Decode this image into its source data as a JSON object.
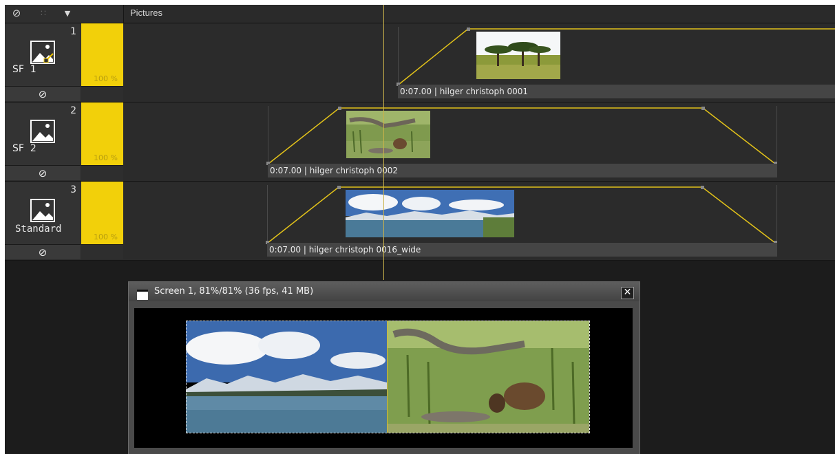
{
  "header": {
    "title": "Pictures",
    "disable_icon": "⊘",
    "dotted_icon": "∷",
    "dropdown_icon": "▼"
  },
  "tracks": [
    {
      "number": "1",
      "name": "SF  1",
      "opacity_label": "100 %",
      "opacity": 1.0,
      "mute_icon": "⊘",
      "clip_label": "0:07.00 | hilger christoph 0001"
    },
    {
      "number": "2",
      "name": "SF  2",
      "opacity_label": "100 %",
      "opacity": 1.0,
      "mute_icon": "⊘",
      "clip_label": "0:07.00 | hilger christoph 0002"
    },
    {
      "number": "3",
      "name": "Standard",
      "opacity_label": "100 %",
      "opacity": 1.0,
      "mute_icon": "⊘",
      "clip_label": "0:07.00 | hilger christoph 0016_wide"
    }
  ],
  "screen_window": {
    "title": "Screen 1, 81%/81% (36 fps, 41 MB)",
    "close_icon": "✕"
  },
  "colors": {
    "accent_yellow": "#f2d00a",
    "background": "#1c1c1c",
    "track_bg": "#2b2b2b"
  }
}
